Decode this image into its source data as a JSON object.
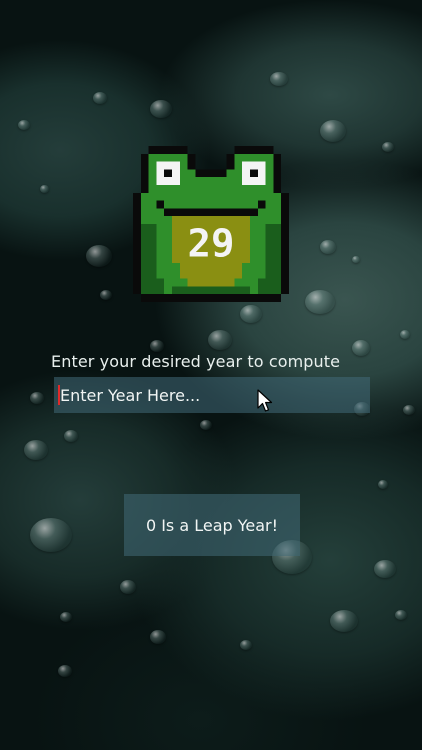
{
  "app": {
    "prompt_label": "Enter your desired year to compute",
    "year_input": {
      "value": "",
      "placeholder": "Enter Year Here..."
    },
    "result_text": "0 Is a Leap Year!",
    "frog_day_number": "29"
  },
  "colors": {
    "frog_green": "#2f8f2b",
    "frog_dark_green": "#1a5e1c",
    "frog_belly": "#8a8f12",
    "outline": "#0a0a0a",
    "input_bg": "#426a78",
    "caret": "#e02a2a"
  },
  "icons": {
    "mascot": "pixel-frog-icon",
    "pointer": "mouse-pointer-icon"
  }
}
